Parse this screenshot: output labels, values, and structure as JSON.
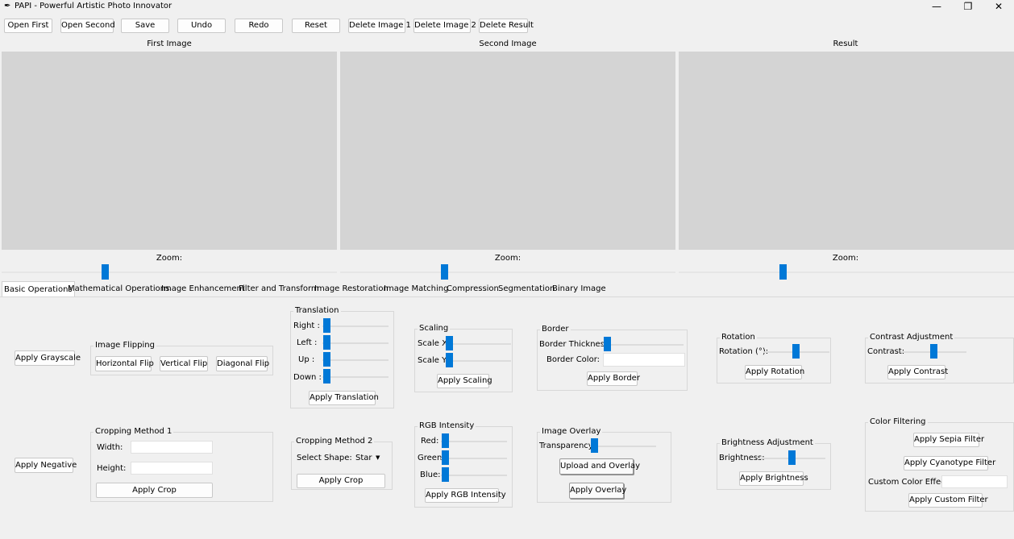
{
  "window": {
    "title": "PAPI - Powerful Artistic Photo Innovator",
    "min": "—",
    "restore": "❐",
    "close": "✕"
  },
  "toolbar": [
    "Open First",
    "Open Second",
    "Save",
    "Undo",
    "Redo",
    "Reset",
    "Delete Image 1",
    "Delete Image 2",
    "Delete Result"
  ],
  "panels": {
    "first": "First Image",
    "second": "Second Image",
    "result": "Result",
    "zoom": "Zoom:"
  },
  "tabs": [
    "Basic Operations",
    "Mathematical Operations",
    "Image Enhancement",
    "Filter and Transform",
    "Image Restoration",
    "Image Matching",
    "Compression",
    "Segmentation",
    "Binary Image"
  ],
  "basic": {
    "grayscale": "Apply Grayscale",
    "negative": "Apply Negative",
    "flipping": {
      "title": "Image Flipping",
      "horizontal": "Horizontal Flip",
      "vertical": "Vertical Flip",
      "diagonal": "Diagonal Flip"
    },
    "crop1": {
      "title": "Cropping Method 1",
      "width": "Width:",
      "height": "Height:",
      "apply": "Apply Crop"
    },
    "translation": {
      "title": "Translation",
      "right": "Right :",
      "left": "Left :",
      "up": "Up :",
      "down": "Down :",
      "apply": "Apply Translation"
    },
    "crop2": {
      "title": "Cropping Method 2",
      "shape_label": "Select Shape:",
      "shape": "Star",
      "arrow": "▼",
      "apply": "Apply Crop"
    },
    "scaling": {
      "title": "Scaling",
      "x": "Scale X:",
      "y": "Scale Y:",
      "apply": "Apply Scaling"
    },
    "rgb": {
      "title": "RGB Intensity",
      "red": "Red:",
      "green": "Green:",
      "blue": "Blue:",
      "apply": "Apply RGB Intensity"
    },
    "border": {
      "title": "Border",
      "thickness": "Border Thickness:",
      "color": "Border Color:",
      "apply": "Apply Border"
    },
    "overlay": {
      "title": "Image Overlay",
      "transparency": "Transparency:",
      "upload": "Upload and Overlay",
      "apply": "Apply Overlay"
    },
    "rotation": {
      "title": "Rotation",
      "label": "Rotation (°):",
      "apply": "Apply Rotation"
    },
    "brightness": {
      "title": "Brightness Adjustment",
      "label": "Brightness:",
      "apply": "Apply Brightness"
    },
    "contrast": {
      "title": "Contrast Adjustment",
      "label": "Contrast:",
      "apply": "Apply Contrast"
    },
    "color": {
      "title": "Color Filtering",
      "sepia": "Apply Sepia Filter",
      "cyanotype": "Apply Cyanotype Filter",
      "custom_label": "Custom Color Effect:",
      "custom": "Apply Custom Filter"
    }
  }
}
